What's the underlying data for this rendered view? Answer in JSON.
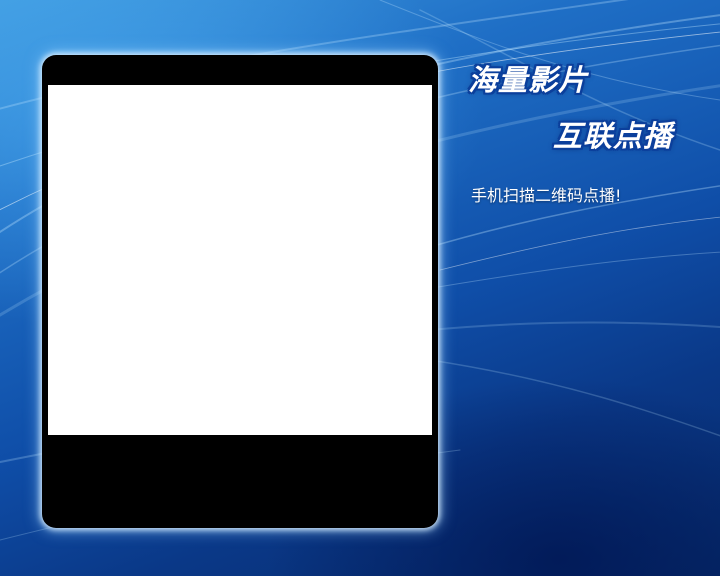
{
  "promo": {
    "headline_line1": "海量影片",
    "headline_line2": "互联点播",
    "scan_prompt": "手机扫描二维码点播!"
  },
  "colors": {
    "background_top": "#3f9be0",
    "background_bottom": "#062a6a",
    "frame": "#000000",
    "screen": "#ffffff",
    "headline_outline": "#0b3f9c"
  }
}
